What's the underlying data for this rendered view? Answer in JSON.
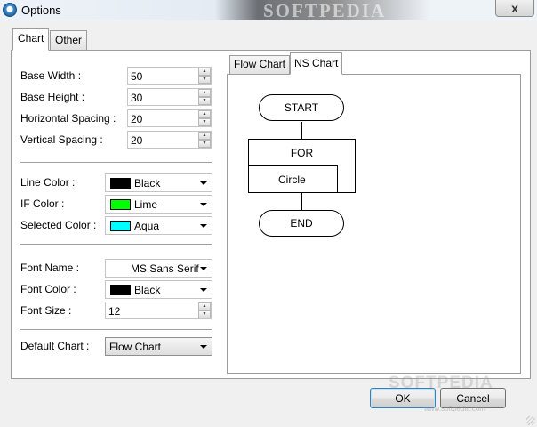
{
  "window": {
    "title": "Options",
    "watermark": "SOFTPEDIA",
    "close_glyph": "x"
  },
  "tabs": {
    "outer": [
      "Chart",
      "Other"
    ],
    "inner": [
      "Flow Chart",
      "NS Chart"
    ]
  },
  "dimensions": {
    "base_width_label": "Base Width :",
    "base_width": "50",
    "base_height_label": "Base Height :",
    "base_height": "30",
    "horizontal_spacing_label": "Horizontal Spacing :",
    "horizontal_spacing": "20",
    "vertical_spacing_label": "Vertical Spacing :",
    "vertical_spacing": "20"
  },
  "colors": {
    "line_color_label": "Line Color :",
    "line_color": "Black",
    "line_color_hex": "#000000",
    "if_color_label": "IF Color :",
    "if_color": "Lime",
    "if_color_hex": "#00ff00",
    "selected_color_label": "Selected Color :",
    "selected_color": "Aqua",
    "selected_color_hex": "#00ffff"
  },
  "font": {
    "name_label": "Font Name :",
    "name": "MS Sans Serif",
    "color_label": "Font Color :",
    "color": "Black",
    "color_hex": "#000000",
    "size_label": "Font Size :",
    "size": "12"
  },
  "default_chart": {
    "label": "Default Chart :",
    "value": "Flow Chart"
  },
  "preview": {
    "start": "START",
    "for": "FOR",
    "circle": "Circle",
    "end": "END"
  },
  "buttons": {
    "ok": "OK",
    "cancel": "Cancel"
  },
  "footer_watermark": {
    "logo": "SOFTPEDIA",
    "url": "www.softpedia.com"
  },
  "icons": {
    "app": "app-icon",
    "close": "close-icon",
    "spin_up": "chevron-up-icon",
    "spin_down": "chevron-down-icon",
    "dropdown": "dropdown-arrow-icon"
  }
}
